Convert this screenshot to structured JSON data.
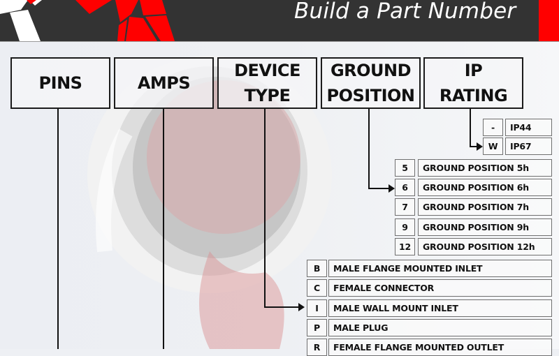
{
  "header": {
    "title": "Build a Part Number",
    "colors": {
      "bar": "#333333",
      "accent": "#ff0000",
      "text": "#ffffff"
    }
  },
  "columns": [
    {
      "id": "pins",
      "label": "PINS"
    },
    {
      "id": "amps",
      "label": "AMPS"
    },
    {
      "id": "device_type",
      "label": "DEVICE TYPE"
    },
    {
      "id": "ground_position",
      "label": "GROUND POSITION"
    },
    {
      "id": "ip_rating",
      "label": "IP RATING"
    }
  ],
  "ip_rating": {
    "options": [
      {
        "code": "-",
        "label": "IP44"
      },
      {
        "code": "W",
        "label": "IP67"
      }
    ]
  },
  "ground_position": {
    "options": [
      {
        "code": "5",
        "label": "GROUND POSITION 5h"
      },
      {
        "code": "6",
        "label": "GROUND POSITION 6h"
      },
      {
        "code": "7",
        "label": "GROUND POSITION 7h"
      },
      {
        "code": "9",
        "label": "GROUND POSITION 9h"
      },
      {
        "code": "12",
        "label": "GROUND POSITION 12h"
      }
    ]
  },
  "device_type": {
    "options": [
      {
        "code": "B",
        "label": "MALE FLANGE MOUNTED INLET"
      },
      {
        "code": "C",
        "label": "FEMALE CONNECTOR"
      },
      {
        "code": "I",
        "label": "MALE WALL MOUNT INLET"
      },
      {
        "code": "P",
        "label": "MALE PLUG"
      },
      {
        "code": "R",
        "label": "FEMALE FLANGE MOUNTED OUTLET"
      }
    ]
  }
}
